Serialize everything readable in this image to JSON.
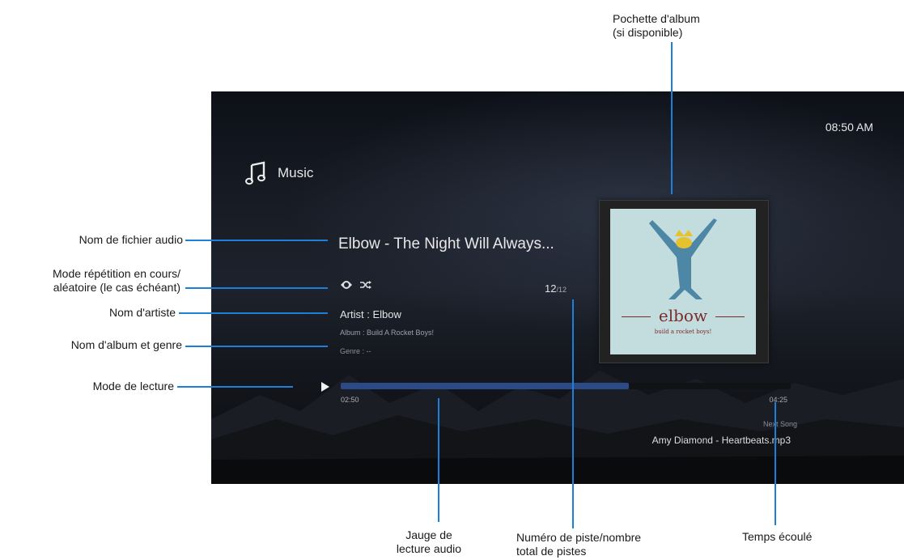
{
  "annotations": {
    "cover_art": "Pochette d'album\n(si disponible)",
    "filename": "Nom de fichier audio",
    "repeat_mode": "Mode répétition en cours/\naléatoire (le cas échéant)",
    "artist_name": "Nom d'artiste",
    "album_genre": "Nom d'album et genre",
    "play_mode": "Mode de lecture",
    "progress_gauge": "Jauge de\nlecture audio",
    "track_number": "Numéro de piste/nombre\ntotal de pistes",
    "elapsed_time": "Temps écoulé"
  },
  "screen": {
    "clock": "08:50 AM",
    "section_title": "Music",
    "song_title": "Elbow - The Night Will Always...",
    "repeat_icon": "repeat-icon",
    "shuffle_icon": "shuffle-icon",
    "track_current": "12",
    "track_total": "/12",
    "artist": "Artist : Elbow",
    "album": "Album : Build A Rocket Boys!",
    "genre": "Genre : --",
    "elapsed": "02:50",
    "total": "04:25",
    "progress_fraction": 0.64,
    "next_label": "Next Song",
    "next_song": "Amy Diamond - Heartbeats.mp3",
    "cover": {
      "band": "elbow",
      "subtitle": "build a rocket boys!"
    }
  },
  "colors": {
    "annotation_line": "#1e7fd8",
    "progress_fill": "#2c4a86"
  }
}
